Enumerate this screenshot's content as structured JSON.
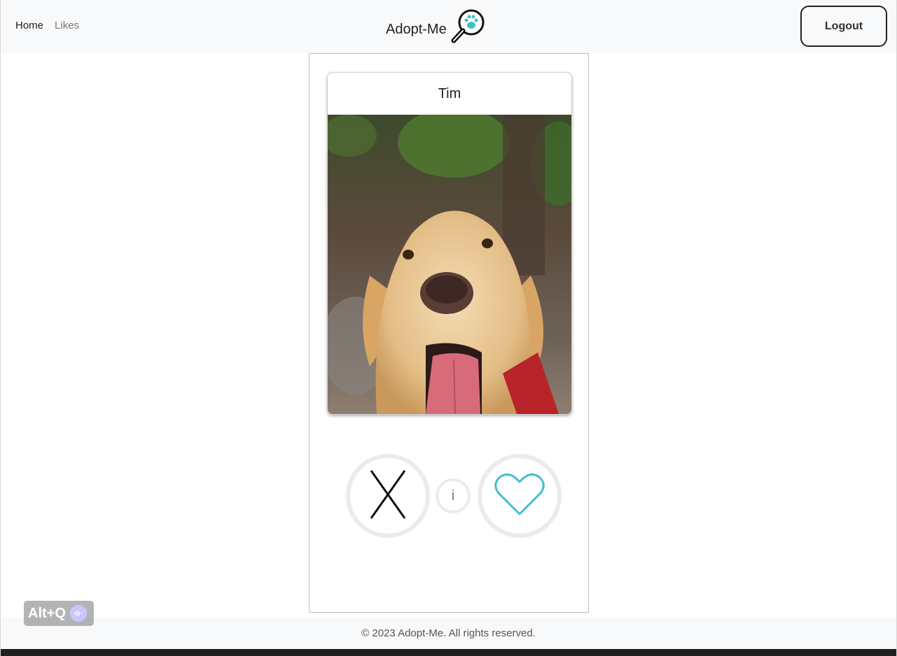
{
  "nav": {
    "home": "Home",
    "likes": "Likes",
    "brand": "Adopt-Me",
    "logo_icon": "magnifier-paw-icon",
    "logout": "Logout"
  },
  "pet": {
    "name": "Tim",
    "photo_icon": "dog-photo"
  },
  "actions": {
    "reject_icon": "x-icon",
    "info_label": "i",
    "like_icon": "heart-icon"
  },
  "footer": {
    "text": "© 2023 Adopt-Me. All rights reserved."
  },
  "overlay": {
    "altq": "Alt+Q"
  },
  "colors": {
    "accent": "#3fc1c9",
    "navbar_bg": "#f8f9fa"
  }
}
